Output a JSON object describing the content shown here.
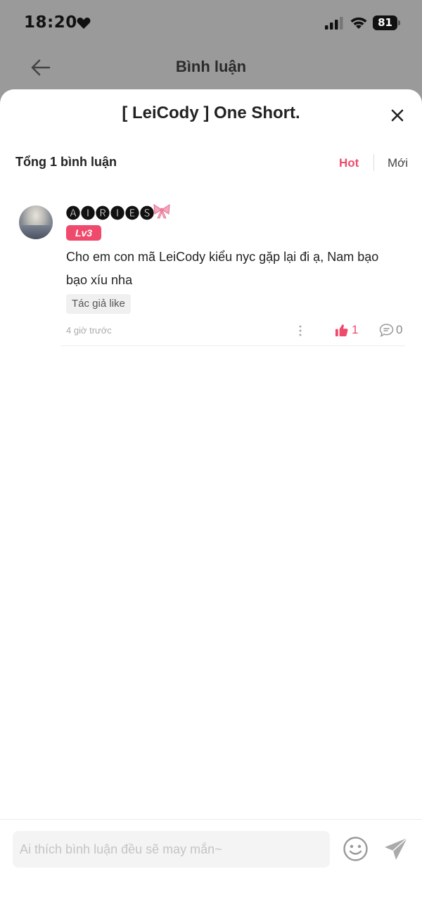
{
  "status_bar": {
    "time": "18:20",
    "battery": "81",
    "icons": [
      "heart-icon",
      "signal-icon",
      "wifi-icon",
      "battery-icon"
    ]
  },
  "header": {
    "title": "Bình luận",
    "back_icon": "arrow-left-icon"
  },
  "sheet": {
    "title": "[ LeiCody ] One Short.",
    "close_icon": "close-icon"
  },
  "summary": {
    "total": "Tổng 1 bình luận",
    "sort_options": [
      "Hot",
      "Mới"
    ],
    "active_sort": "Hot"
  },
  "comments": [
    {
      "username": "🅐🅘🅡🅘🅔🅢",
      "username_emoji": "bow-icon",
      "level": "Lv3",
      "text": "Cho em con mã LeiCody kiểu nyc gặp lại đi ạ, Nam bạo bạo xíu nha",
      "tag": "Tác giả like",
      "time": "4 giờ trước",
      "likes": "1",
      "replies": "0"
    }
  ],
  "composer": {
    "placeholder": "Ai thích bình luận đều sẽ may mắn~",
    "emoji_icon": "emoji-icon",
    "send_icon": "send-icon"
  },
  "colors": {
    "accent": "#ee4d6b",
    "overlay": "#9a9a9a",
    "sheet": "#ffffff"
  }
}
